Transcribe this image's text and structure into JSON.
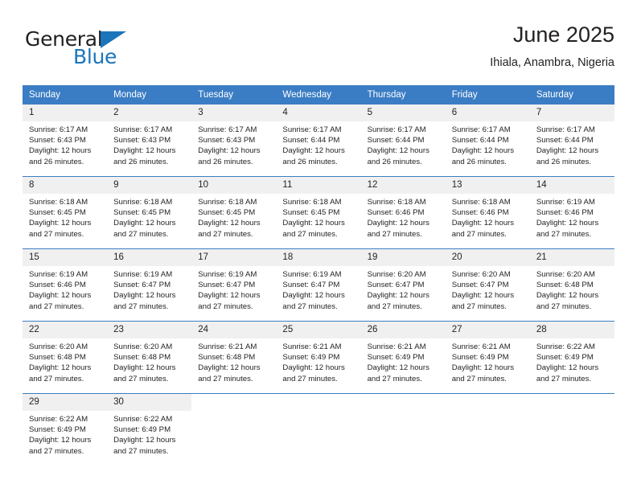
{
  "logo": {
    "word_one": "General",
    "word_two": "Blue",
    "triangle_color": "#1b75bb",
    "icon": "triangle-right-icon"
  },
  "header": {
    "title": "June 2025",
    "subtitle": "Ihiala, Anambra, Nigeria"
  },
  "theme": {
    "header_bg": "#3b7dc4",
    "daynum_bg": "#f0f0f0",
    "text": "#231f20",
    "accent": "#1b75bb"
  },
  "calendar": {
    "weekday_headers": [
      "Sunday",
      "Monday",
      "Tuesday",
      "Wednesday",
      "Thursday",
      "Friday",
      "Saturday"
    ],
    "weeks": [
      [
        {
          "day": "1",
          "sunrise": "Sunrise: 6:17 AM",
          "sunset": "Sunset: 6:43 PM",
          "daylight1": "Daylight: 12 hours",
          "daylight2": "and 26 minutes."
        },
        {
          "day": "2",
          "sunrise": "Sunrise: 6:17 AM",
          "sunset": "Sunset: 6:43 PM",
          "daylight1": "Daylight: 12 hours",
          "daylight2": "and 26 minutes."
        },
        {
          "day": "3",
          "sunrise": "Sunrise: 6:17 AM",
          "sunset": "Sunset: 6:43 PM",
          "daylight1": "Daylight: 12 hours",
          "daylight2": "and 26 minutes."
        },
        {
          "day": "4",
          "sunrise": "Sunrise: 6:17 AM",
          "sunset": "Sunset: 6:44 PM",
          "daylight1": "Daylight: 12 hours",
          "daylight2": "and 26 minutes."
        },
        {
          "day": "5",
          "sunrise": "Sunrise: 6:17 AM",
          "sunset": "Sunset: 6:44 PM",
          "daylight1": "Daylight: 12 hours",
          "daylight2": "and 26 minutes."
        },
        {
          "day": "6",
          "sunrise": "Sunrise: 6:17 AM",
          "sunset": "Sunset: 6:44 PM",
          "daylight1": "Daylight: 12 hours",
          "daylight2": "and 26 minutes."
        },
        {
          "day": "7",
          "sunrise": "Sunrise: 6:17 AM",
          "sunset": "Sunset: 6:44 PM",
          "daylight1": "Daylight: 12 hours",
          "daylight2": "and 26 minutes."
        }
      ],
      [
        {
          "day": "8",
          "sunrise": "Sunrise: 6:18 AM",
          "sunset": "Sunset: 6:45 PM",
          "daylight1": "Daylight: 12 hours",
          "daylight2": "and 27 minutes."
        },
        {
          "day": "9",
          "sunrise": "Sunrise: 6:18 AM",
          "sunset": "Sunset: 6:45 PM",
          "daylight1": "Daylight: 12 hours",
          "daylight2": "and 27 minutes."
        },
        {
          "day": "10",
          "sunrise": "Sunrise: 6:18 AM",
          "sunset": "Sunset: 6:45 PM",
          "daylight1": "Daylight: 12 hours",
          "daylight2": "and 27 minutes."
        },
        {
          "day": "11",
          "sunrise": "Sunrise: 6:18 AM",
          "sunset": "Sunset: 6:45 PM",
          "daylight1": "Daylight: 12 hours",
          "daylight2": "and 27 minutes."
        },
        {
          "day": "12",
          "sunrise": "Sunrise: 6:18 AM",
          "sunset": "Sunset: 6:46 PM",
          "daylight1": "Daylight: 12 hours",
          "daylight2": "and 27 minutes."
        },
        {
          "day": "13",
          "sunrise": "Sunrise: 6:18 AM",
          "sunset": "Sunset: 6:46 PM",
          "daylight1": "Daylight: 12 hours",
          "daylight2": "and 27 minutes."
        },
        {
          "day": "14",
          "sunrise": "Sunrise: 6:19 AM",
          "sunset": "Sunset: 6:46 PM",
          "daylight1": "Daylight: 12 hours",
          "daylight2": "and 27 minutes."
        }
      ],
      [
        {
          "day": "15",
          "sunrise": "Sunrise: 6:19 AM",
          "sunset": "Sunset: 6:46 PM",
          "daylight1": "Daylight: 12 hours",
          "daylight2": "and 27 minutes."
        },
        {
          "day": "16",
          "sunrise": "Sunrise: 6:19 AM",
          "sunset": "Sunset: 6:47 PM",
          "daylight1": "Daylight: 12 hours",
          "daylight2": "and 27 minutes."
        },
        {
          "day": "17",
          "sunrise": "Sunrise: 6:19 AM",
          "sunset": "Sunset: 6:47 PM",
          "daylight1": "Daylight: 12 hours",
          "daylight2": "and 27 minutes."
        },
        {
          "day": "18",
          "sunrise": "Sunrise: 6:19 AM",
          "sunset": "Sunset: 6:47 PM",
          "daylight1": "Daylight: 12 hours",
          "daylight2": "and 27 minutes."
        },
        {
          "day": "19",
          "sunrise": "Sunrise: 6:20 AM",
          "sunset": "Sunset: 6:47 PM",
          "daylight1": "Daylight: 12 hours",
          "daylight2": "and 27 minutes."
        },
        {
          "day": "20",
          "sunrise": "Sunrise: 6:20 AM",
          "sunset": "Sunset: 6:47 PM",
          "daylight1": "Daylight: 12 hours",
          "daylight2": "and 27 minutes."
        },
        {
          "day": "21",
          "sunrise": "Sunrise: 6:20 AM",
          "sunset": "Sunset: 6:48 PM",
          "daylight1": "Daylight: 12 hours",
          "daylight2": "and 27 minutes."
        }
      ],
      [
        {
          "day": "22",
          "sunrise": "Sunrise: 6:20 AM",
          "sunset": "Sunset: 6:48 PM",
          "daylight1": "Daylight: 12 hours",
          "daylight2": "and 27 minutes."
        },
        {
          "day": "23",
          "sunrise": "Sunrise: 6:20 AM",
          "sunset": "Sunset: 6:48 PM",
          "daylight1": "Daylight: 12 hours",
          "daylight2": "and 27 minutes."
        },
        {
          "day": "24",
          "sunrise": "Sunrise: 6:21 AM",
          "sunset": "Sunset: 6:48 PM",
          "daylight1": "Daylight: 12 hours",
          "daylight2": "and 27 minutes."
        },
        {
          "day": "25",
          "sunrise": "Sunrise: 6:21 AM",
          "sunset": "Sunset: 6:49 PM",
          "daylight1": "Daylight: 12 hours",
          "daylight2": "and 27 minutes."
        },
        {
          "day": "26",
          "sunrise": "Sunrise: 6:21 AM",
          "sunset": "Sunset: 6:49 PM",
          "daylight1": "Daylight: 12 hours",
          "daylight2": "and 27 minutes."
        },
        {
          "day": "27",
          "sunrise": "Sunrise: 6:21 AM",
          "sunset": "Sunset: 6:49 PM",
          "daylight1": "Daylight: 12 hours",
          "daylight2": "and 27 minutes."
        },
        {
          "day": "28",
          "sunrise": "Sunrise: 6:22 AM",
          "sunset": "Sunset: 6:49 PM",
          "daylight1": "Daylight: 12 hours",
          "daylight2": "and 27 minutes."
        }
      ],
      [
        {
          "day": "29",
          "sunrise": "Sunrise: 6:22 AM",
          "sunset": "Sunset: 6:49 PM",
          "daylight1": "Daylight: 12 hours",
          "daylight2": "and 27 minutes."
        },
        {
          "day": "30",
          "sunrise": "Sunrise: 6:22 AM",
          "sunset": "Sunset: 6:49 PM",
          "daylight1": "Daylight: 12 hours",
          "daylight2": "and 27 minutes."
        },
        {
          "day": "",
          "sunrise": "",
          "sunset": "",
          "daylight1": "",
          "daylight2": ""
        },
        {
          "day": "",
          "sunrise": "",
          "sunset": "",
          "daylight1": "",
          "daylight2": ""
        },
        {
          "day": "",
          "sunrise": "",
          "sunset": "",
          "daylight1": "",
          "daylight2": ""
        },
        {
          "day": "",
          "sunrise": "",
          "sunset": "",
          "daylight1": "",
          "daylight2": ""
        },
        {
          "day": "",
          "sunrise": "",
          "sunset": "",
          "daylight1": "",
          "daylight2": ""
        }
      ]
    ]
  }
}
